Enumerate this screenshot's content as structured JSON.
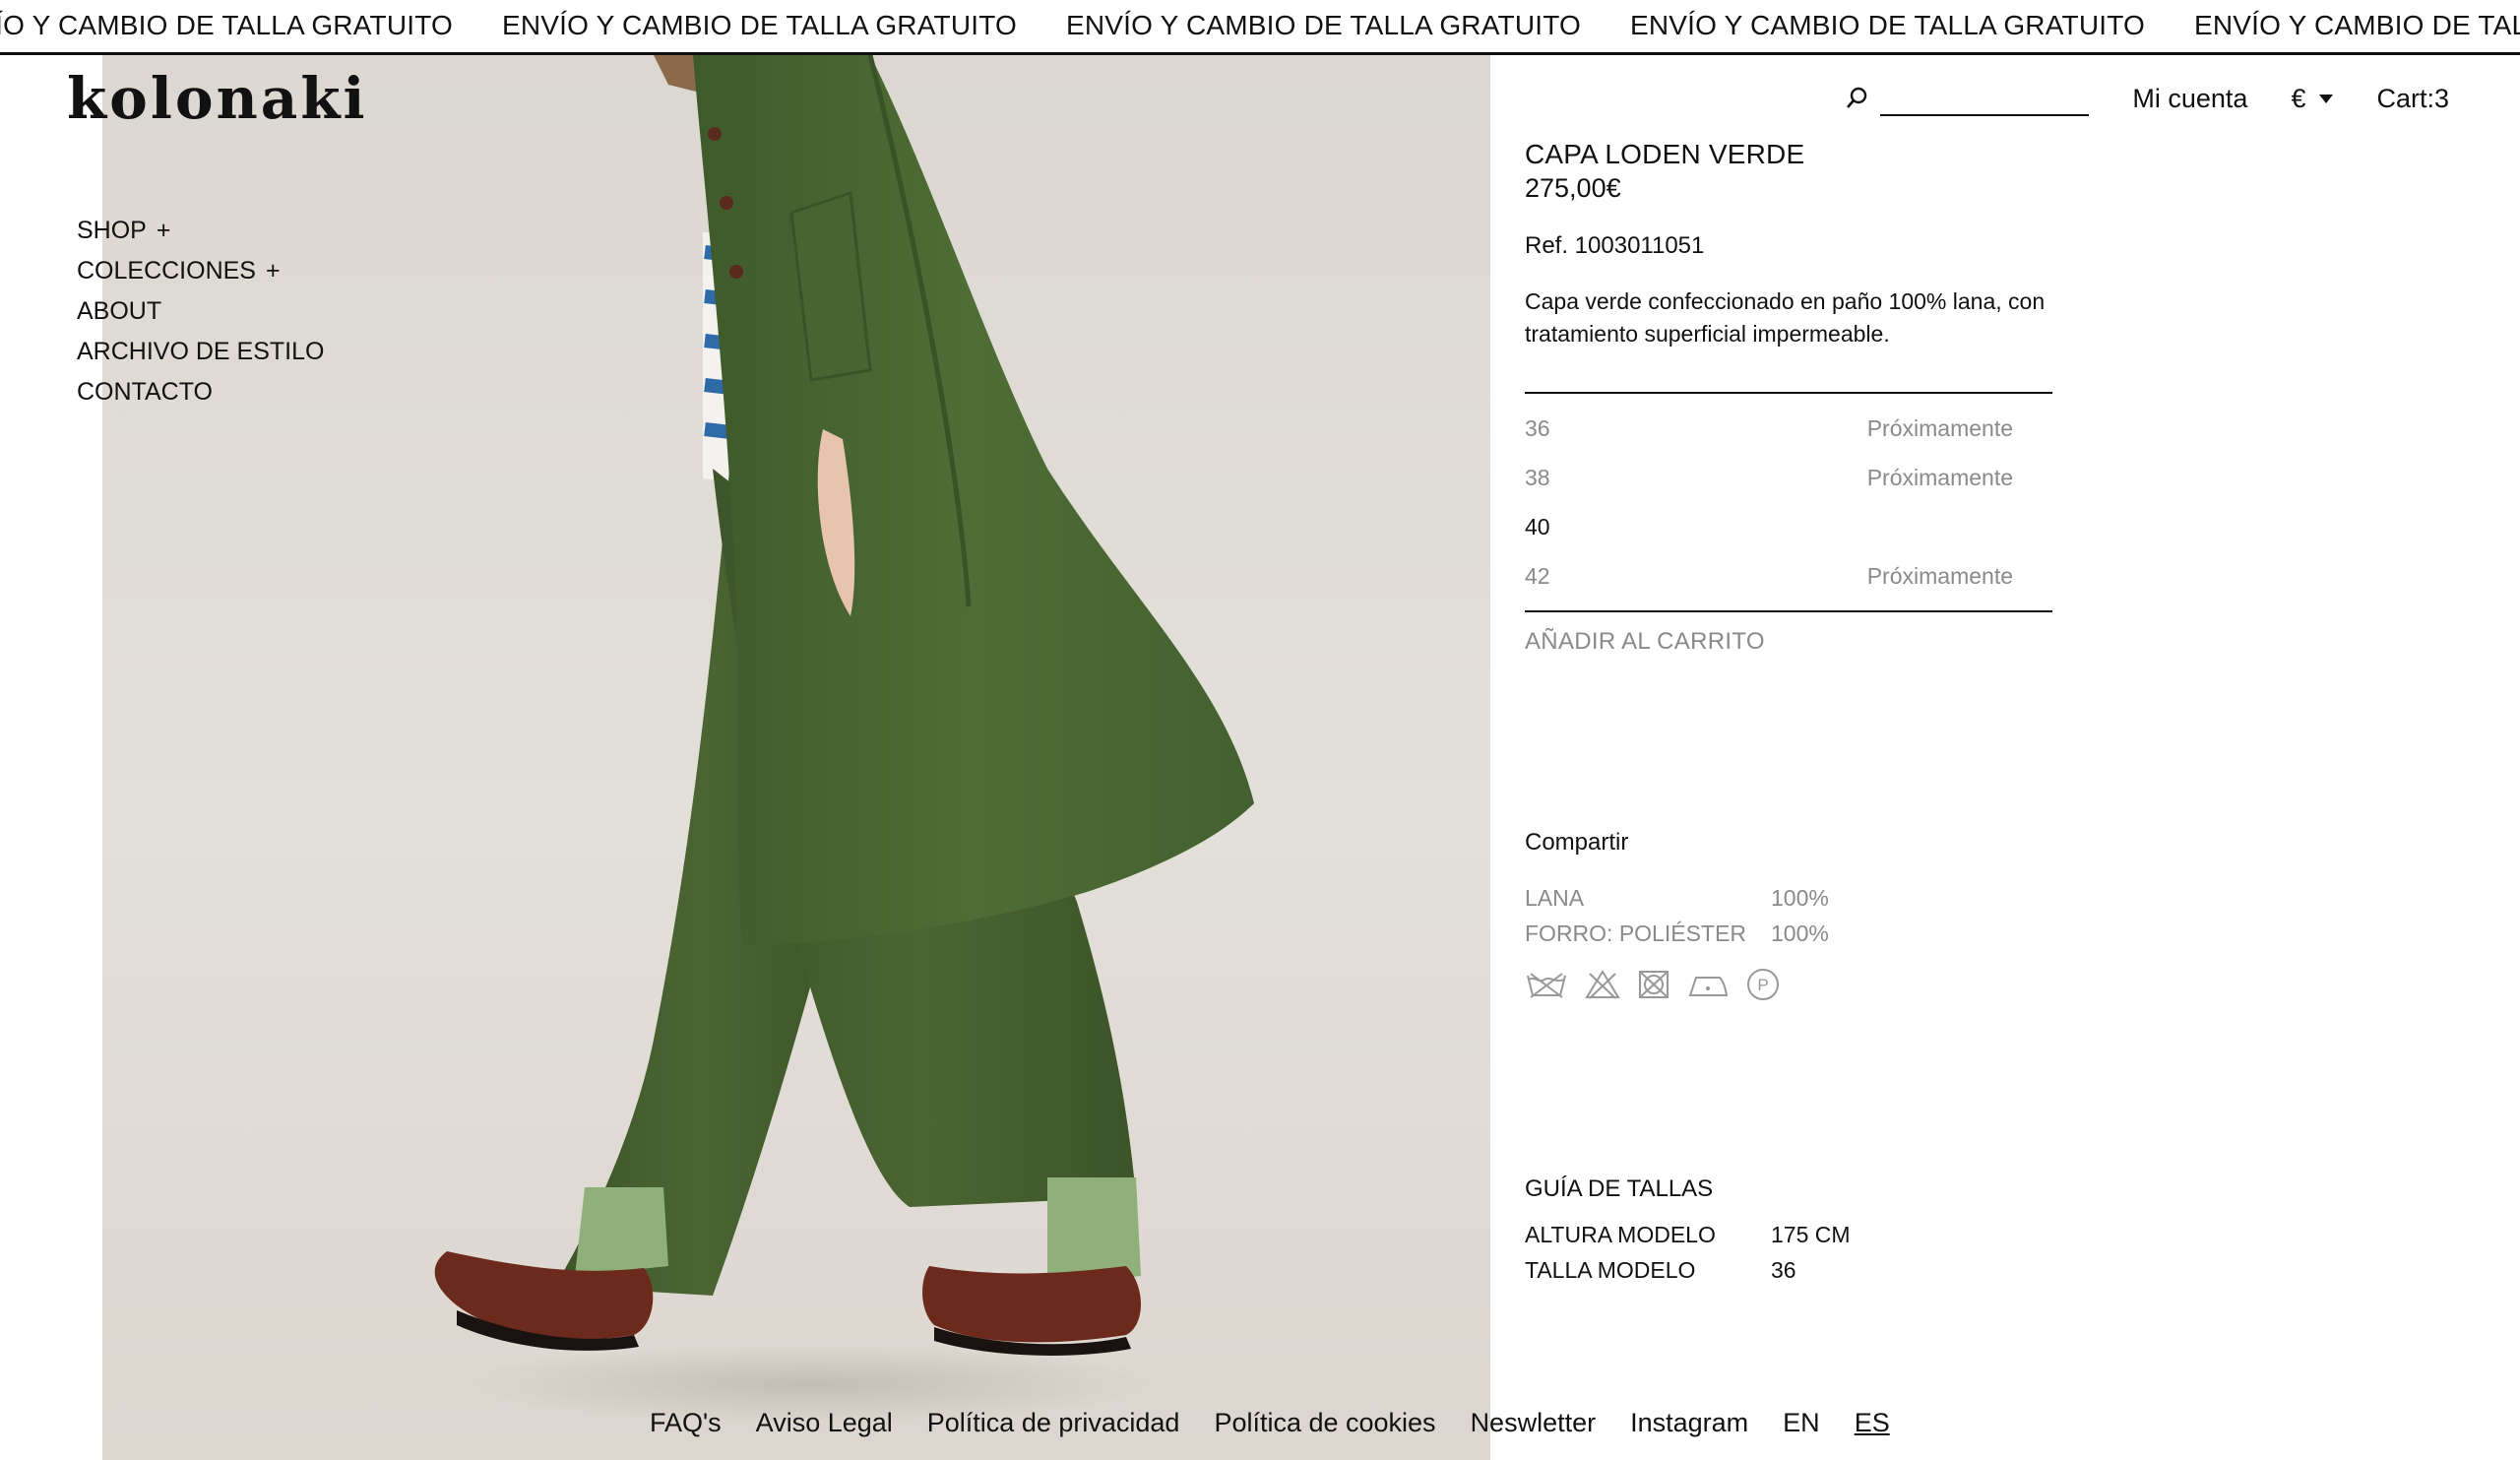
{
  "announcement": {
    "text": "ENVÍO Y CAMBIO DE TALLA GRATUITO",
    "items": [
      "ENVÍO Y CAMBIO DE TALLA GRATUITO",
      "ENVÍO Y CAMBIO DE TALLA GRATUITO",
      "ENVÍO Y CAMBIO DE TALLA GRATUITO",
      "ENVÍO Y CAMBIO DE TALLA GRATUITO",
      "ENVÍO Y CAMBIO DE TALLA GRATUITO"
    ]
  },
  "brand": {
    "logo": "kolonaki"
  },
  "nav": {
    "items": [
      {
        "label": "SHOP",
        "expand": "+"
      },
      {
        "label": "COLECCIONES",
        "expand": "+"
      },
      {
        "label": "ABOUT",
        "expand": ""
      },
      {
        "label": "ARCHIVO DE ESTILO",
        "expand": ""
      },
      {
        "label": "CONTACTO",
        "expand": ""
      }
    ]
  },
  "header": {
    "search_icon": "search-icon",
    "search_value": "",
    "account_label": "Mi cuenta",
    "currency": "€",
    "cart_label": "Cart:3"
  },
  "product": {
    "title": "CAPA LODEN VERDE",
    "price": "275,00€",
    "ref": "Ref. 1003011051",
    "description": "Capa verde confeccionado en paño 100% lana, con tratamiento superficial impermeable.",
    "sizes": [
      {
        "size": "36",
        "status": "Próximamente",
        "available": false
      },
      {
        "size": "38",
        "status": "Próximamente",
        "available": false
      },
      {
        "size": "40",
        "status": "",
        "available": true
      },
      {
        "size": "42",
        "status": "Próximamente",
        "available": false
      }
    ],
    "add_to_cart": "AÑADIR AL CARRITO",
    "share": "Compartir",
    "composition": [
      {
        "material": "LANA",
        "percent": "100%"
      },
      {
        "material": "FORRO: POLIÉSTER",
        "percent": "100%"
      }
    ],
    "care_icons": [
      "wash-icon",
      "no-bleach-icon",
      "no-tumble-dry-icon",
      "iron-icon",
      "dry-clean-p-icon"
    ],
    "care_p_letter": "P",
    "size_guide": {
      "title": "GUÍA DE TALLAS",
      "rows": [
        {
          "label": "ALTURA MODELO",
          "value": "175 CM"
        },
        {
          "label": "TALLA MODELO",
          "value": "36"
        }
      ]
    }
  },
  "footer": {
    "links": [
      "FAQ's",
      "Aviso Legal",
      "Política de privacidad",
      "Política de cookies",
      "Neswletter",
      "Instagram"
    ],
    "languages": [
      "EN",
      "ES"
    ],
    "active_language": "ES"
  },
  "colors": {
    "background": "#ffffff",
    "text": "#111111",
    "muted": "#8a8a8a",
    "cape_green": "#4d6a33",
    "sock_green": "#8fb07a",
    "shoe_brown": "#6b2a1c"
  }
}
